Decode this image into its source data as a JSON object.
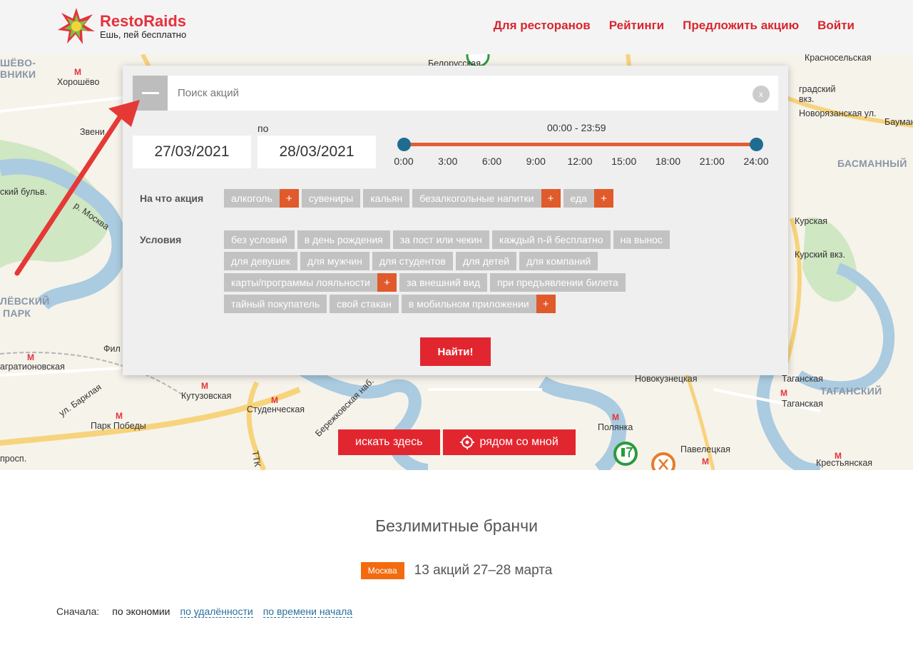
{
  "header": {
    "brand": "RestoRaids",
    "slogan": "Ешь, пей бесплатно",
    "nav": [
      "Для ресторанов",
      "Рейтинги",
      "Предложить акцию",
      "Войти"
    ]
  },
  "map": {
    "labels": [
      {
        "text": "ШЁВО-",
        "cls": "district"
      },
      {
        "text": "ВНИКИ",
        "cls": "district"
      },
      {
        "text": "Хорошёво",
        "cls": ""
      },
      {
        "text": "Звени",
        "cls": ""
      },
      {
        "text": "Красносельская",
        "cls": ""
      },
      {
        "text": "Белорусская",
        "cls": ""
      },
      {
        "text": "градский",
        "cls": ""
      },
      {
        "text": "вкз.",
        "cls": ""
      },
      {
        "text": "Новорязанская ул.",
        "cls": ""
      },
      {
        "text": "Бауман",
        "cls": ""
      },
      {
        "text": "БАСМАННЫЙ",
        "cls": "district"
      },
      {
        "text": "ский бульв.",
        "cls": ""
      },
      {
        "text": "р. Москва",
        "cls": ""
      },
      {
        "text": "Курская",
        "cls": ""
      },
      {
        "text": "Курский вкз.",
        "cls": ""
      },
      {
        "text": "ЛЁВСКИЙ",
        "cls": "district"
      },
      {
        "text": "ПАРК",
        "cls": "district"
      },
      {
        "text": "Фил",
        "cls": ""
      },
      {
        "text": "агратионовская",
        "cls": ""
      },
      {
        "text": "Кутузовская",
        "cls": ""
      },
      {
        "text": "Студенческая",
        "cls": ""
      },
      {
        "text": "Парк Победы",
        "cls": ""
      },
      {
        "text": "ул. Барклая",
        "cls": ""
      },
      {
        "text": "просп.",
        "cls": ""
      },
      {
        "text": "Бережковская наб.",
        "cls": ""
      },
      {
        "text": "Новокузнецкая",
        "cls": ""
      },
      {
        "text": "Полянка",
        "cls": ""
      },
      {
        "text": "Таганская",
        "cls": ""
      },
      {
        "text": "ТАГАНСКИЙ",
        "cls": "district"
      },
      {
        "text": "Павелецкая",
        "cls": ""
      },
      {
        "text": "Крестьянская",
        "cls": ""
      },
      {
        "text": "ТТК",
        "cls": ""
      }
    ],
    "btn_here": "искать здесь",
    "btn_near": "рядом со мной"
  },
  "search": {
    "placeholder": "Поиск акций",
    "clear": "x",
    "to_label": "по",
    "date_from": "27/03/2021",
    "date_to": "28/03/2021",
    "time_range": "00:00 - 23:59",
    "ticks": [
      "0:00",
      "3:00",
      "6:00",
      "9:00",
      "12:00",
      "15:00",
      "18:00",
      "21:00",
      "24:00"
    ],
    "what_label": "На что акция",
    "what_tags": [
      {
        "label": "алкоголь",
        "plus": true
      },
      {
        "label": "сувениры",
        "plus": false
      },
      {
        "label": "кальян",
        "plus": false
      },
      {
        "label": "безалкогольные напитки",
        "plus": true
      },
      {
        "label": "еда",
        "plus": true
      }
    ],
    "cond_label": "Условия",
    "cond_rows": [
      [
        {
          "label": "без условий",
          "plus": false
        },
        {
          "label": "в день рождения",
          "plus": false
        },
        {
          "label": "за пост или чекин",
          "plus": false
        },
        {
          "label": "каждый n-й бесплатно",
          "plus": false
        },
        {
          "label": "на вынос",
          "plus": false
        }
      ],
      [
        {
          "label": "для девушек",
          "plus": false
        },
        {
          "label": "для мужчин",
          "plus": false
        },
        {
          "label": "для студентов",
          "plus": false
        },
        {
          "label": "для детей",
          "plus": false
        },
        {
          "label": "для компаний",
          "plus": false
        }
      ],
      [
        {
          "label": "карты/программы лояльности",
          "plus": true
        },
        {
          "label": "за внешний вид",
          "plus": false
        },
        {
          "label": "при предъявлении билета",
          "plus": false
        }
      ],
      [
        {
          "label": "тайный покупатель",
          "plus": false
        },
        {
          "label": "свой стакан",
          "plus": false
        },
        {
          "label": "в мобильном приложении",
          "plus": true
        }
      ]
    ],
    "plus_symbol": "+",
    "find_label": "Найти!"
  },
  "content": {
    "title": "Безлимитные бранчи",
    "city": "Москва",
    "summary": "13 акций 27–28 марта",
    "sort_label": "Сначала:",
    "sort_active": "по экономии",
    "sort_options": [
      "по удалённости",
      "по времени начала"
    ]
  },
  "colors": {
    "brand_red": "#e2262f",
    "tag_gray": "#c2c2c2",
    "plus_orange": "#e05a2b",
    "slider_blue": "#1f6c93"
  }
}
